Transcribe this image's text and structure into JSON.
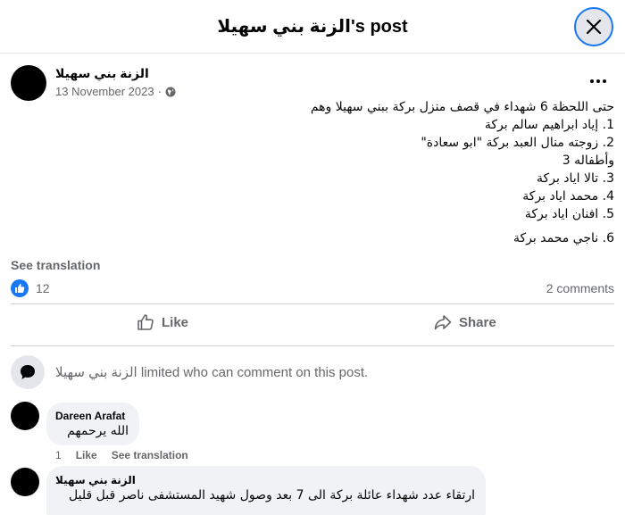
{
  "header": {
    "title": "الزنة بني سهيلا's post"
  },
  "post": {
    "author": "الزنة بني سهيلا",
    "date": "13 November 2023",
    "privacy_icon": "globe-icon",
    "lines": [
      "حتى اللحظة 6 شهداء في قصف منزل بركة ببني سهيلا وهم",
      "1. إياد ابراهيم سالم بركة",
      "2. زوجته  منال العبد  بركة \"ابو سعادة\"",
      "وأطفاله 3",
      "3. تالا اياد بركة",
      "4. محمد اياد بركة",
      "5. افنان اياد بركة",
      "6. ناجي محمد بركة"
    ],
    "see_translation": "See translation",
    "reaction_count": "12",
    "comment_count": "2 comments",
    "like_label": "Like",
    "share_label": "Share"
  },
  "limited_notice": "الزنة بني سهيلا limited who can comment on this post.",
  "comments": [
    {
      "author": "Dareen Arafat",
      "text": "الله يرحمهم",
      "time": "1",
      "like_label": "Like",
      "translate_label": "See translation"
    },
    {
      "author": "الزنة بني سهيلا",
      "text": "ارتقاء عدد شهداء عائلة بركة الى 7 بعد وصول شهيد المستشفى ناصر قبل قليل"
    }
  ],
  "colors": {
    "accent": "#1877f2",
    "secondary_text": "#65676b",
    "bubble": "#f0f2f5"
  }
}
